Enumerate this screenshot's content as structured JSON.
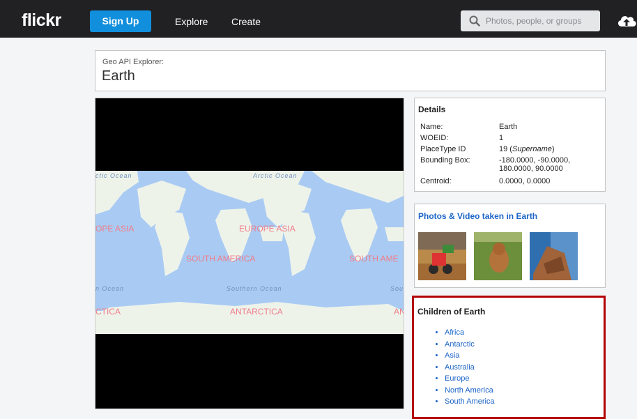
{
  "topbar": {
    "logo": "flickr",
    "signup_label": "Sign Up",
    "nav": [
      "Explore",
      "Create"
    ],
    "search_placeholder": "Photos, people, or groups"
  },
  "header": {
    "subtitle": "Geo API Explorer:",
    "title": "Earth"
  },
  "map": {
    "ocean_labels": [
      "ctic Ocean",
      "Arctic Ocean",
      "n Ocean",
      "Southern Ocean",
      "Sou"
    ],
    "continent_labels": [
      "OPE ASIA",
      "EUROPE ASIA",
      "SOUTH AMERICA",
      "SOUTH AME",
      "CTICA",
      "ANTARCTICA",
      "AN"
    ]
  },
  "details": {
    "heading": "Details",
    "rows": [
      {
        "label": "Name:",
        "value": "Earth"
      },
      {
        "label": "WOEID:",
        "value": "1"
      },
      {
        "label": "PlaceType ID",
        "value": "19",
        "note": "Supername"
      },
      {
        "label": "Bounding Box:",
        "value": "-180.0000, -90.0000, 180.0000, 90.0000"
      },
      {
        "label": "Centroid:",
        "value": "0.0000, 0.0000"
      }
    ]
  },
  "photos": {
    "heading": "Photos & Video taken in Earth"
  },
  "children": {
    "heading": "Children of Earth",
    "items": [
      "Africa",
      "Antarctic",
      "Asia",
      "Australia",
      "Europe",
      "North America",
      "South America"
    ]
  },
  "colors": {
    "topbar": "#212124",
    "signup": "#128fdc",
    "link": "#1c65c8",
    "highlight_border": "#b40000",
    "ocean": "#a9cbf3",
    "land": "#eef3ea"
  }
}
